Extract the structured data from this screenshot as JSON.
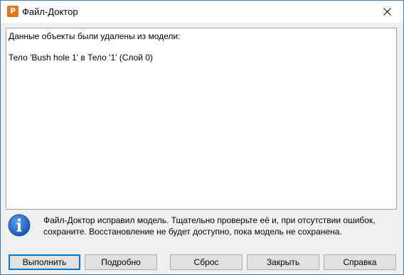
{
  "window": {
    "title": "Файл-Доктор",
    "app_icon_letter": "P",
    "accent": "#e8731f"
  },
  "log": {
    "lines": [
      "Данные объекты были удалены из модели:",
      "",
      "Тело 'Bush hole 1' в Тело '1' (Слой 0)"
    ]
  },
  "message": {
    "icon": "info-icon",
    "text": "Файл-Доктор исправил модель. Тщательно проверьте её и, при отсутствии ошибок, сохраните. Восстановление не будет доступно, пока модель не сохранена."
  },
  "buttons": {
    "execute": "Выполнить",
    "details": "Подробно",
    "reset": "Сброс",
    "close": "Закрыть",
    "help": "Справка"
  }
}
